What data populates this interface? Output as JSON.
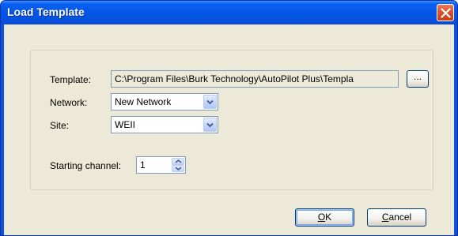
{
  "window": {
    "title": "Load Template"
  },
  "form": {
    "template": {
      "label": "Template:",
      "value": "C:\\Program Files\\Burk Technology\\AutoPilot Plus\\Templa",
      "browse_label": "..."
    },
    "network": {
      "label": "Network:",
      "value": "New Network"
    },
    "site": {
      "label": "Site:",
      "value": "WEII"
    },
    "starting_channel": {
      "label": "Starting channel:",
      "value": "1"
    }
  },
  "buttons": {
    "ok": {
      "mnemonic": "O",
      "rest": "K"
    },
    "cancel": {
      "mnemonic": "C",
      "rest": "ancel"
    }
  },
  "icons": {
    "close": "close-icon",
    "dropdown": "chevron-down-icon",
    "spin_up": "spin-up-icon",
    "spin_down": "spin-down-icon"
  },
  "colors": {
    "titlebar": "#0552e0",
    "close_button": "#d8502c",
    "dialog_background": "#ece9d8"
  }
}
